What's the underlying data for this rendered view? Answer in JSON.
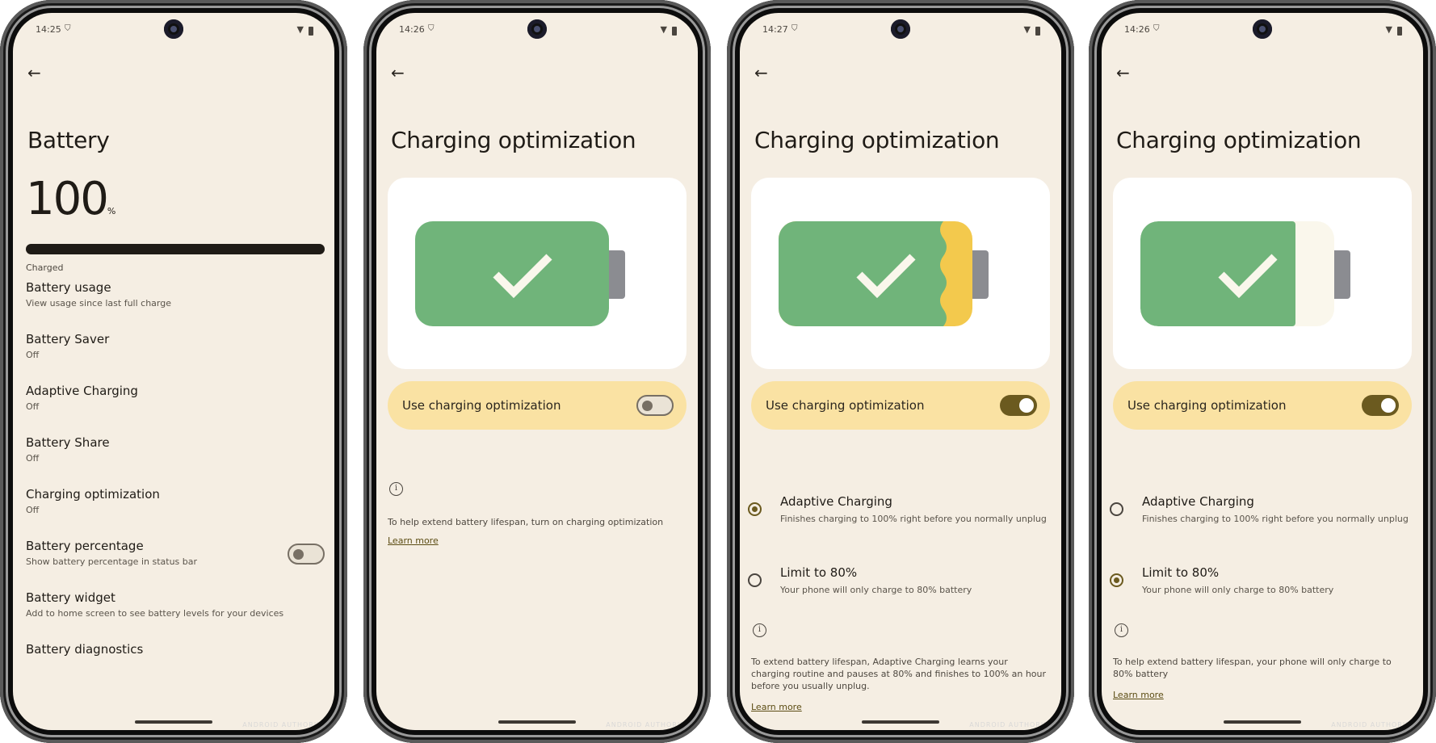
{
  "colors": {
    "screen_bg": "#f5eee3",
    "accent": "#6b5a1f",
    "battery_green": "#70b47a",
    "battery_yellow": "#f3c94d",
    "battery_cream": "#faf7ec",
    "option_card": "#fae2a3"
  },
  "phones": [
    {
      "status": {
        "time": "14:25",
        "vpn_icon": "vpn-key-icon",
        "wifi_icon": "wifi-icon",
        "battery_icon": "battery-icon"
      },
      "back_icon": "←",
      "title": "Battery",
      "battery_level": {
        "value": "100",
        "unit": "%",
        "fill_percent": 100
      },
      "status_label": "Charged",
      "items": [
        {
          "title": "Battery usage",
          "subtitle": "View usage since last full charge"
        },
        {
          "title": "Battery Saver",
          "subtitle": "Off"
        },
        {
          "title": "Adaptive Charging",
          "subtitle": "Off"
        },
        {
          "title": "Battery Share",
          "subtitle": "Off"
        },
        {
          "title": "Charging optimization",
          "subtitle": "Off"
        },
        {
          "title": "Battery percentage",
          "subtitle": "Show battery percentage in status bar",
          "toggle": false
        },
        {
          "title": "Battery widget",
          "subtitle": "Add to home screen to see battery levels for your devices"
        },
        {
          "title": "Battery diagnostics",
          "subtitle": ""
        }
      ],
      "watermark": "ANDROID AUTHORITY"
    },
    {
      "status": {
        "time": "14:26"
      },
      "back_icon": "←",
      "title": "Charging optimization",
      "illustration": "full-battery-check",
      "toggle_label": "Use charging optimization",
      "toggle_on": false,
      "info_icon": "i",
      "info_text": "To help extend battery lifespan, turn on charging optimization",
      "learn_more": "Learn more",
      "watermark": "ANDROID AUTHORITY"
    },
    {
      "status": {
        "time": "14:27"
      },
      "back_icon": "←",
      "title": "Charging optimization",
      "illustration": "adaptive-charging-battery",
      "toggle_label": "Use charging optimization",
      "toggle_on": true,
      "options": [
        {
          "title": "Adaptive Charging",
          "subtitle": "Finishes charging to 100% right before you normally unplug",
          "selected": true
        },
        {
          "title": "Limit to 80%",
          "subtitle": "Your phone will only charge to 80% battery",
          "selected": false
        }
      ],
      "info_icon": "i",
      "info_text": "To extend battery lifespan, Adaptive Charging learns your charging routine and pauses at 80% and finishes to 100% an hour before you usually unplug.",
      "learn_more": "Learn more",
      "watermark": "ANDROID AUTHORITY"
    },
    {
      "status": {
        "time": "14:26"
      },
      "back_icon": "←",
      "title": "Charging optimization",
      "illustration": "limit-80-battery",
      "toggle_label": "Use charging optimization",
      "toggle_on": true,
      "options": [
        {
          "title": "Adaptive Charging",
          "subtitle": "Finishes charging to 100% right before you normally unplug",
          "selected": false
        },
        {
          "title": "Limit to 80%",
          "subtitle": "Your phone will only charge to 80% battery",
          "selected": true
        }
      ],
      "info_icon": "i",
      "info_text": "To help extend battery lifespan, your phone will only charge to 80% battery",
      "learn_more": "Learn more",
      "watermark": "ANDROID AUTHORITY"
    }
  ]
}
